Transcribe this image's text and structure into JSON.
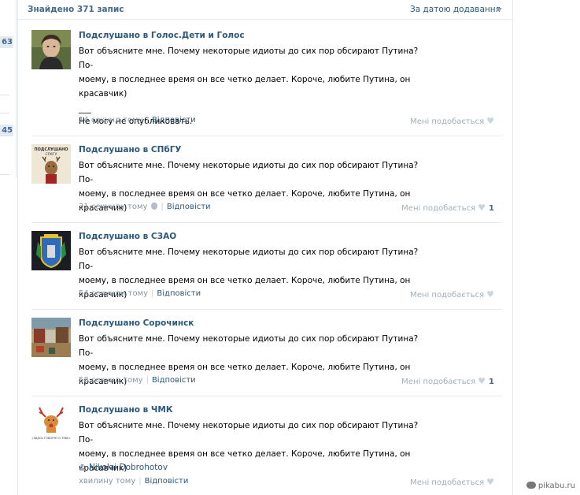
{
  "sidebar": {
    "counts": [
      "63",
      "45"
    ]
  },
  "header": {
    "found_text": "Знайдено 371 запис",
    "sort_label": "За датою додавання"
  },
  "posts": [
    {
      "author": "Подслушано в Голос.Дети и Голос",
      "lines": [
        "Вот объясните мне. Почему некоторые идиоты до сих пор обсирают Путина? По-",
        "моему, в последнее время он все четко делает. Короче, любите Путина, он",
        "красавчик)"
      ],
      "extra_lines": [
        "___",
        "Не могу не опубликовать."
      ],
      "time": "14 секунд тому",
      "reply": "Відповісти",
      "like": "Мені подобається",
      "like_count": ""
    },
    {
      "author": "Подслушано в СПбГУ",
      "lines": [
        "Вот объясните мне. Почему некоторые идиоты до сих пор обсирают Путина? По-",
        "моему, в последнее время он все четко делает. Короче, любите Путина, он",
        "красавчик)"
      ],
      "time": "31 секунду тому",
      "reply": "Відповісти",
      "like": "Мені подобається",
      "like_count": "1",
      "avatar_text": "ПОДСЛУШАНО СПбГУ"
    },
    {
      "author": "Подслушано в СЗАО",
      "lines": [
        "Вот объясните мне. Почему некоторые идиоты до сих пор обсирают Путина? По-",
        "моему, в последнее время он все четко делает. Короче, любите Путина, он",
        "красавчик)"
      ],
      "time": "54 секунди тому",
      "reply": "Відповісти",
      "like": "Мені подобається",
      "like_count": ""
    },
    {
      "author": "Подслушано Сорочинск",
      "lines": [
        "Вот объясните мне. Почему некоторые идиоты до сих пор обсирают Путина? По-",
        "моему, в последнее время он все четко делает. Короче, любите Путина, он",
        "красавчик)"
      ],
      "time": "58 секунд тому",
      "reply": "Відповісти",
      "like": "Мені подобається",
      "like_count": "1"
    },
    {
      "author": "Подслушано в ЧМК",
      "lines": [
        "Вот объясните мне. Почему некоторые идиоты до сих пор обсирают Путина? По-",
        "моему, в последнее время он все четко делает. Короче, любите Путина, он",
        "красавчик)"
      ],
      "signer": "Nikolai Dobrohotov",
      "time": "хвилину тому",
      "reply": "Відповісти",
      "like": "Мені подобається",
      "like_count": "",
      "avatar_text": "«ЗДЕСЬ ГОВОРЯТ О ТЕБЕ»"
    }
  ],
  "watermark": "pikabu.ru",
  "colors": {
    "link": "#2b587a",
    "header_text": "#45688e",
    "meta": "#8a96a4",
    "separator": "#e7ebf0"
  }
}
